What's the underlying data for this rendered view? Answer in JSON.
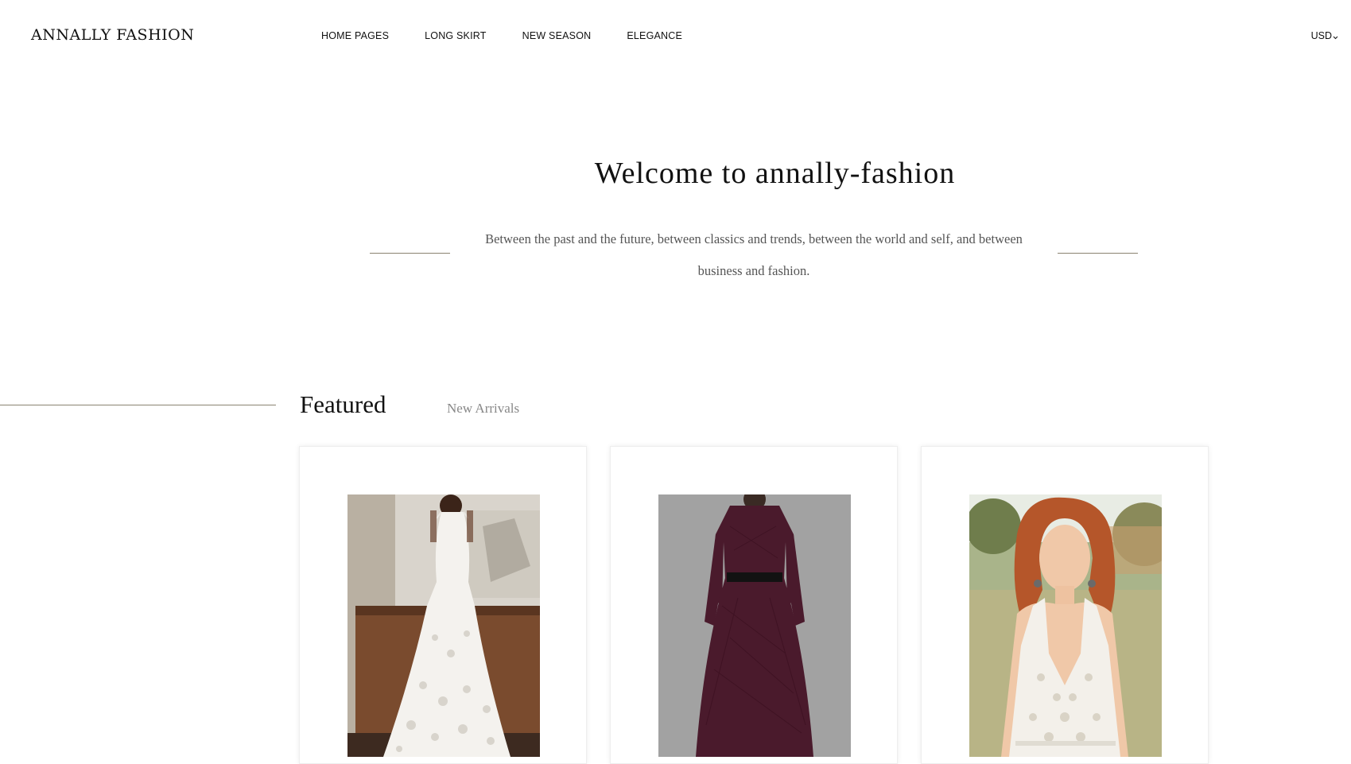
{
  "header": {
    "logo": "ANNALLY FASHION",
    "nav": [
      "HOME PAGES",
      "LONG SKIRT",
      "NEW SEASON",
      "ELEGANCE"
    ],
    "currency": "USD",
    "currency_icon": "chevron-down-icon"
  },
  "welcome": {
    "title": "Welcome to annally-fashion",
    "text": "Between the past and the future, between classics and trends, between the world and self, and between business and fashion."
  },
  "section": {
    "tabs": [
      "Featured",
      "New Arrivals"
    ],
    "active_tab": "Featured"
  },
  "products": [
    {
      "image": "white lace sleeveless maxi dress (back view)"
    },
    {
      "image": "burgundy lace long-sleeve maxi dress with black belt (back view)"
    },
    {
      "image": "white crochet lace top on red-haired model"
    }
  ],
  "colors": {
    "rule": "#8a8371",
    "text": "#111111",
    "muted": "#888888"
  }
}
